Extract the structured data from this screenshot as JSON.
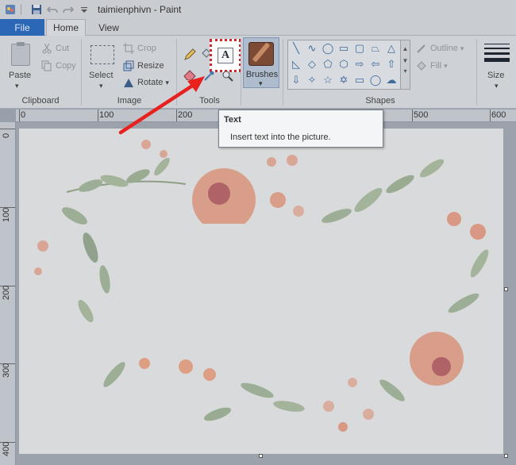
{
  "window": {
    "title": "taimienphivn - Paint"
  },
  "quick_access": {
    "icons": [
      "app-menu-icon",
      "save-icon",
      "undo-icon",
      "redo-icon",
      "customize-icon"
    ]
  },
  "tabs": {
    "file": "File",
    "home": "Home",
    "view": "View"
  },
  "ribbon": {
    "clipboard": {
      "paste": "Paste",
      "cut": "Cut",
      "copy": "Copy",
      "group": "Clipboard"
    },
    "image": {
      "select": "Select",
      "crop": "Crop",
      "resize": "Resize",
      "rotate": "Rotate",
      "group": "Image"
    },
    "tools": {
      "text_glyph": "A",
      "group": "Tools"
    },
    "brushes": {
      "label": "Brushes"
    },
    "shapes": {
      "outline": "Outline",
      "fill": "Fill",
      "group": "Shapes"
    },
    "size": {
      "label": "Size"
    }
  },
  "tooltip": {
    "title": "Text",
    "description": "Insert text into the picture."
  },
  "ruler": {
    "top_labels": [
      "0",
      "100",
      "200",
      "500",
      "600"
    ],
    "left_labels": [
      "0",
      "100",
      "200",
      "300",
      "400"
    ]
  },
  "colors": {
    "highlight": "#d2262a",
    "file_tab": "#2b67b5",
    "arrow": "#e8201e"
  }
}
